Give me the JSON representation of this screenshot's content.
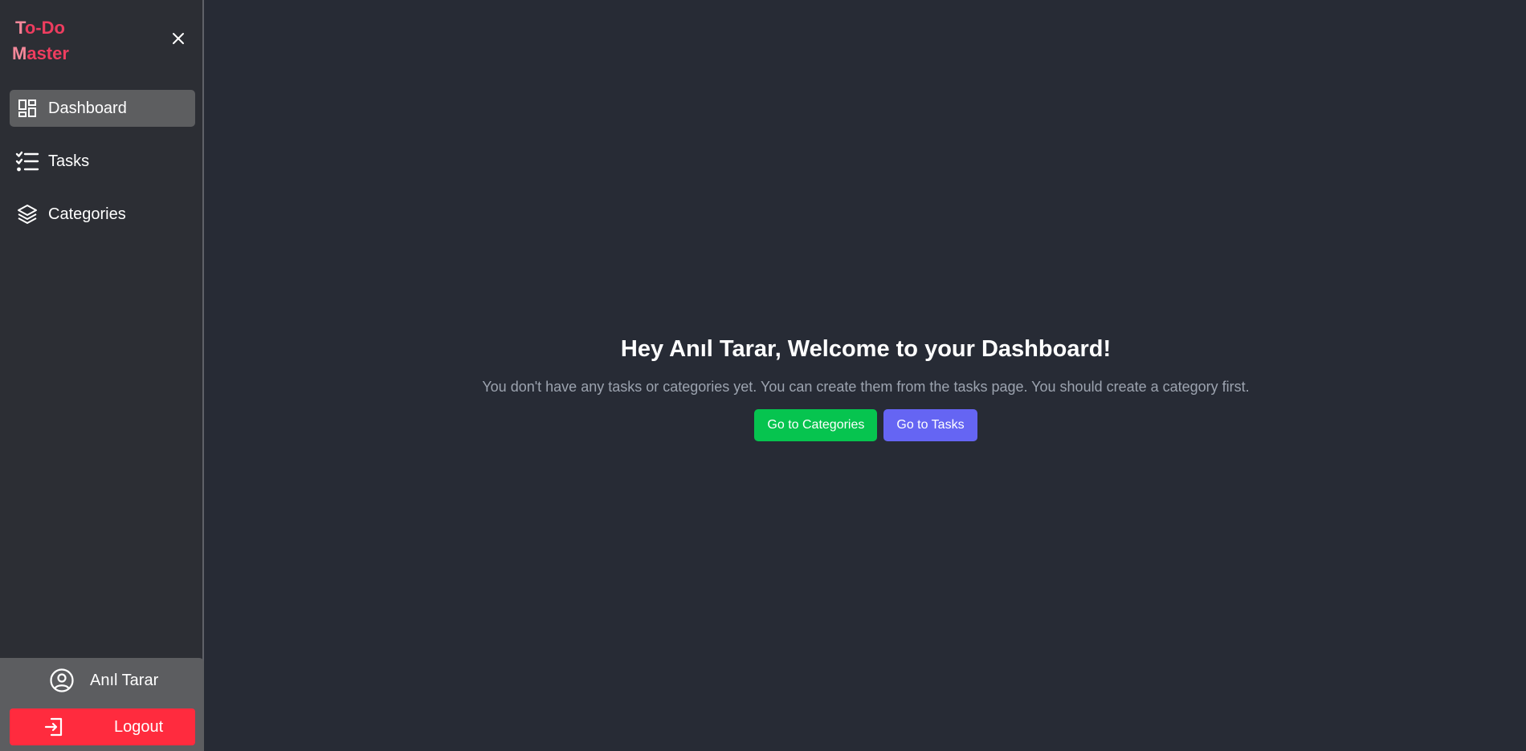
{
  "brand": {
    "line1": "To-Do",
    "line2": "Master"
  },
  "sidebar": {
    "items": [
      {
        "label": "Dashboard",
        "icon": "dashboard-icon",
        "active": true
      },
      {
        "label": "Tasks",
        "icon": "checklist-icon",
        "active": false
      },
      {
        "label": "Categories",
        "icon": "layers-icon",
        "active": false
      }
    ]
  },
  "user": {
    "name": "Anıl Tarar",
    "icon": "user-circle-icon"
  },
  "logout": {
    "label": "Logout",
    "icon": "logout-icon"
  },
  "main": {
    "heading": "Hey Anıl Tarar, Welcome to your Dashboard!",
    "message": "You don't have any tasks or categories yet. You can create them from the tasks page. You should create a category first.",
    "buttons": {
      "categories": "Go to Categories",
      "tasks": "Go to Tasks"
    }
  },
  "colors": {
    "background": "#272b35",
    "sidebar": "#2c2e34",
    "brand": "#ee3d5f",
    "active_nav": "#5d5e60",
    "logout": "#ff2b3e",
    "green_button": "#06c44f",
    "indigo_button": "#6565f3"
  }
}
